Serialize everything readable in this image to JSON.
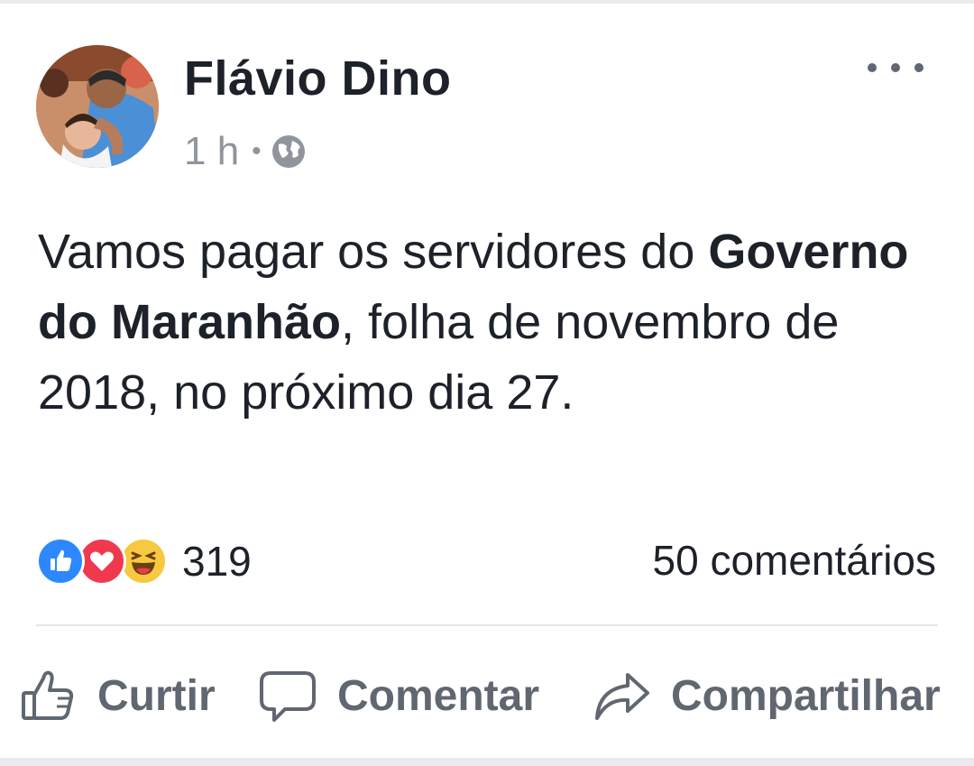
{
  "post": {
    "author": "Flávio Dino",
    "time": "1 h",
    "separator": "•",
    "privacy_icon": "globe-icon",
    "text_part1": "Vamos pagar os servidores do ",
    "text_bold": "Governo do Maranhão",
    "text_part2": ", folha de novembro de 2018, no próximo dia 27."
  },
  "reactions": {
    "icons": [
      "like-reaction-icon",
      "love-reaction-icon",
      "haha-reaction-icon"
    ],
    "count": "319",
    "comments": "50 comentários"
  },
  "actions": {
    "like": "Curtir",
    "comment": "Comentar",
    "share": "Compartilhar"
  },
  "colors": {
    "like_blue": "#2d88ff",
    "love_red": "#f0394f",
    "haha_yellow": "#f7c940",
    "muted_text": "#90949c",
    "action_text": "#606770"
  }
}
